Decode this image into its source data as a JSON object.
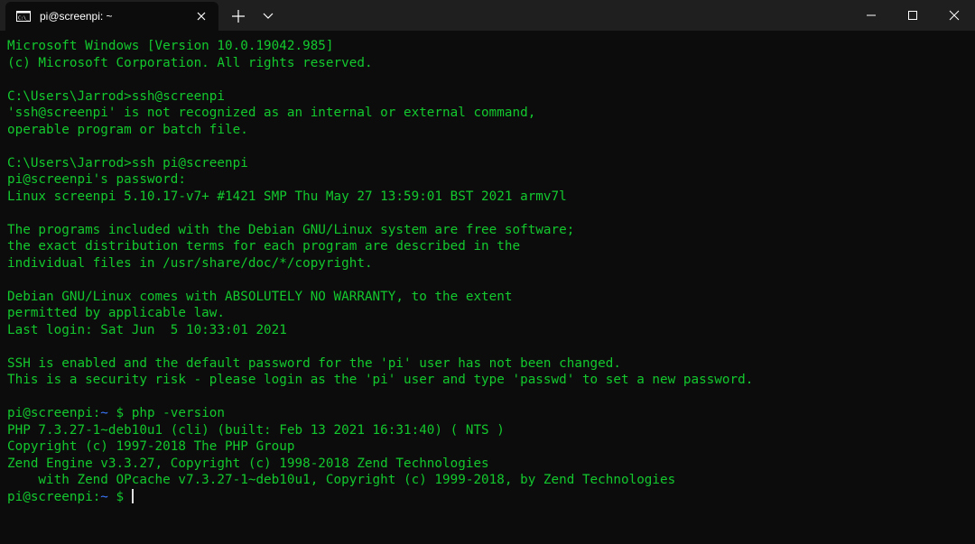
{
  "window": {
    "tab_title": "pi@screenpi: ~",
    "tab_icon": "terminal-icon",
    "new_tab_icon": "plus-icon",
    "dropdown_icon": "chevron-down-icon",
    "caption_icons": [
      "minimize-icon",
      "maximize-icon",
      "close-icon"
    ]
  },
  "colors": {
    "background": "#0c0c0c",
    "titlebar": "#1f1f1f",
    "text": "#13c92e",
    "prompt_path": "#3b78ff"
  },
  "terminal": {
    "lines": [
      "Microsoft Windows [Version 10.0.19042.985]",
      "(c) Microsoft Corporation. All rights reserved.",
      "",
      "C:\\Users\\Jarrod>ssh@screenpi",
      "'ssh@screenpi' is not recognized as an internal or external command,",
      "operable program or batch file.",
      "",
      "C:\\Users\\Jarrod>ssh pi@screenpi",
      "pi@screenpi's password:",
      "Linux screenpi 5.10.17-v7+ #1421 SMP Thu May 27 13:59:01 BST 2021 armv7l",
      "",
      "The programs included with the Debian GNU/Linux system are free software;",
      "the exact distribution terms for each program are described in the",
      "individual files in /usr/share/doc/*/copyright.",
      "",
      "Debian GNU/Linux comes with ABSOLUTELY NO WARRANTY, to the extent",
      "permitted by applicable law.",
      "Last login: Sat Jun  5 10:33:01 2021",
      "",
      "SSH is enabled and the default password for the 'pi' user has not been changed.",
      "This is a security risk - please login as the 'pi' user and type 'passwd' to set a new password."
    ],
    "prompt_user_host": "pi@screenpi",
    "prompt_colon": ":",
    "prompt_path": "~",
    "prompt_symbol": " $",
    "command": " php -version",
    "output": [
      "PHP 7.3.27-1~deb10u1 (cli) (built: Feb 13 2021 16:31:40) ( NTS )",
      "Copyright (c) 1997-2018 The PHP Group",
      "Zend Engine v3.3.27, Copyright (c) 1998-2018 Zend Technologies",
      "    with Zend OPcache v7.3.27-1~deb10u1, Copyright (c) 1999-2018, by Zend Technologies"
    ]
  }
}
